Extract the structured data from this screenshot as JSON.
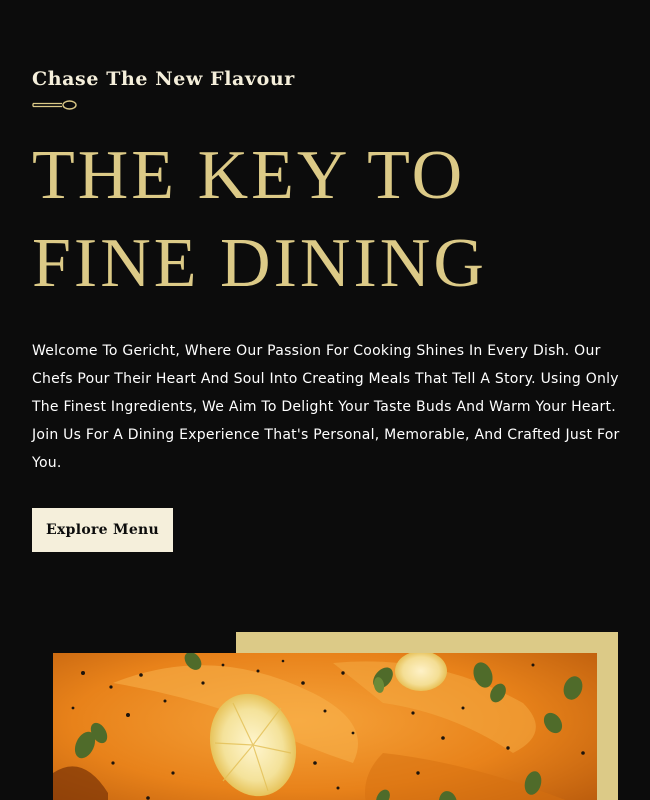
{
  "hero": {
    "subtitle": "Chase The New Flavour",
    "spoon_icon": "spoon-divider-icon",
    "headline_line1": "THE KEY TO",
    "headline_line2": "FINE DINING",
    "description": "Welcome To Gericht, Where Our Passion For Cooking Shines In Every Dish. Our Chefs Pour Their Heart And Soul Into Creating Meals That Tell A Story. Using Only The Finest Ingredients, We Aim To Delight Your Taste Buds And Warm Your Heart. Join Us For A Dining Experience That's Personal, Memorable, And Crafted Just For You.",
    "cta_label": "Explore Menu"
  },
  "colors": {
    "background": "#0c0c0c",
    "gold": "#dcca87",
    "cream": "#f5efdb",
    "white": "#ffffff"
  }
}
